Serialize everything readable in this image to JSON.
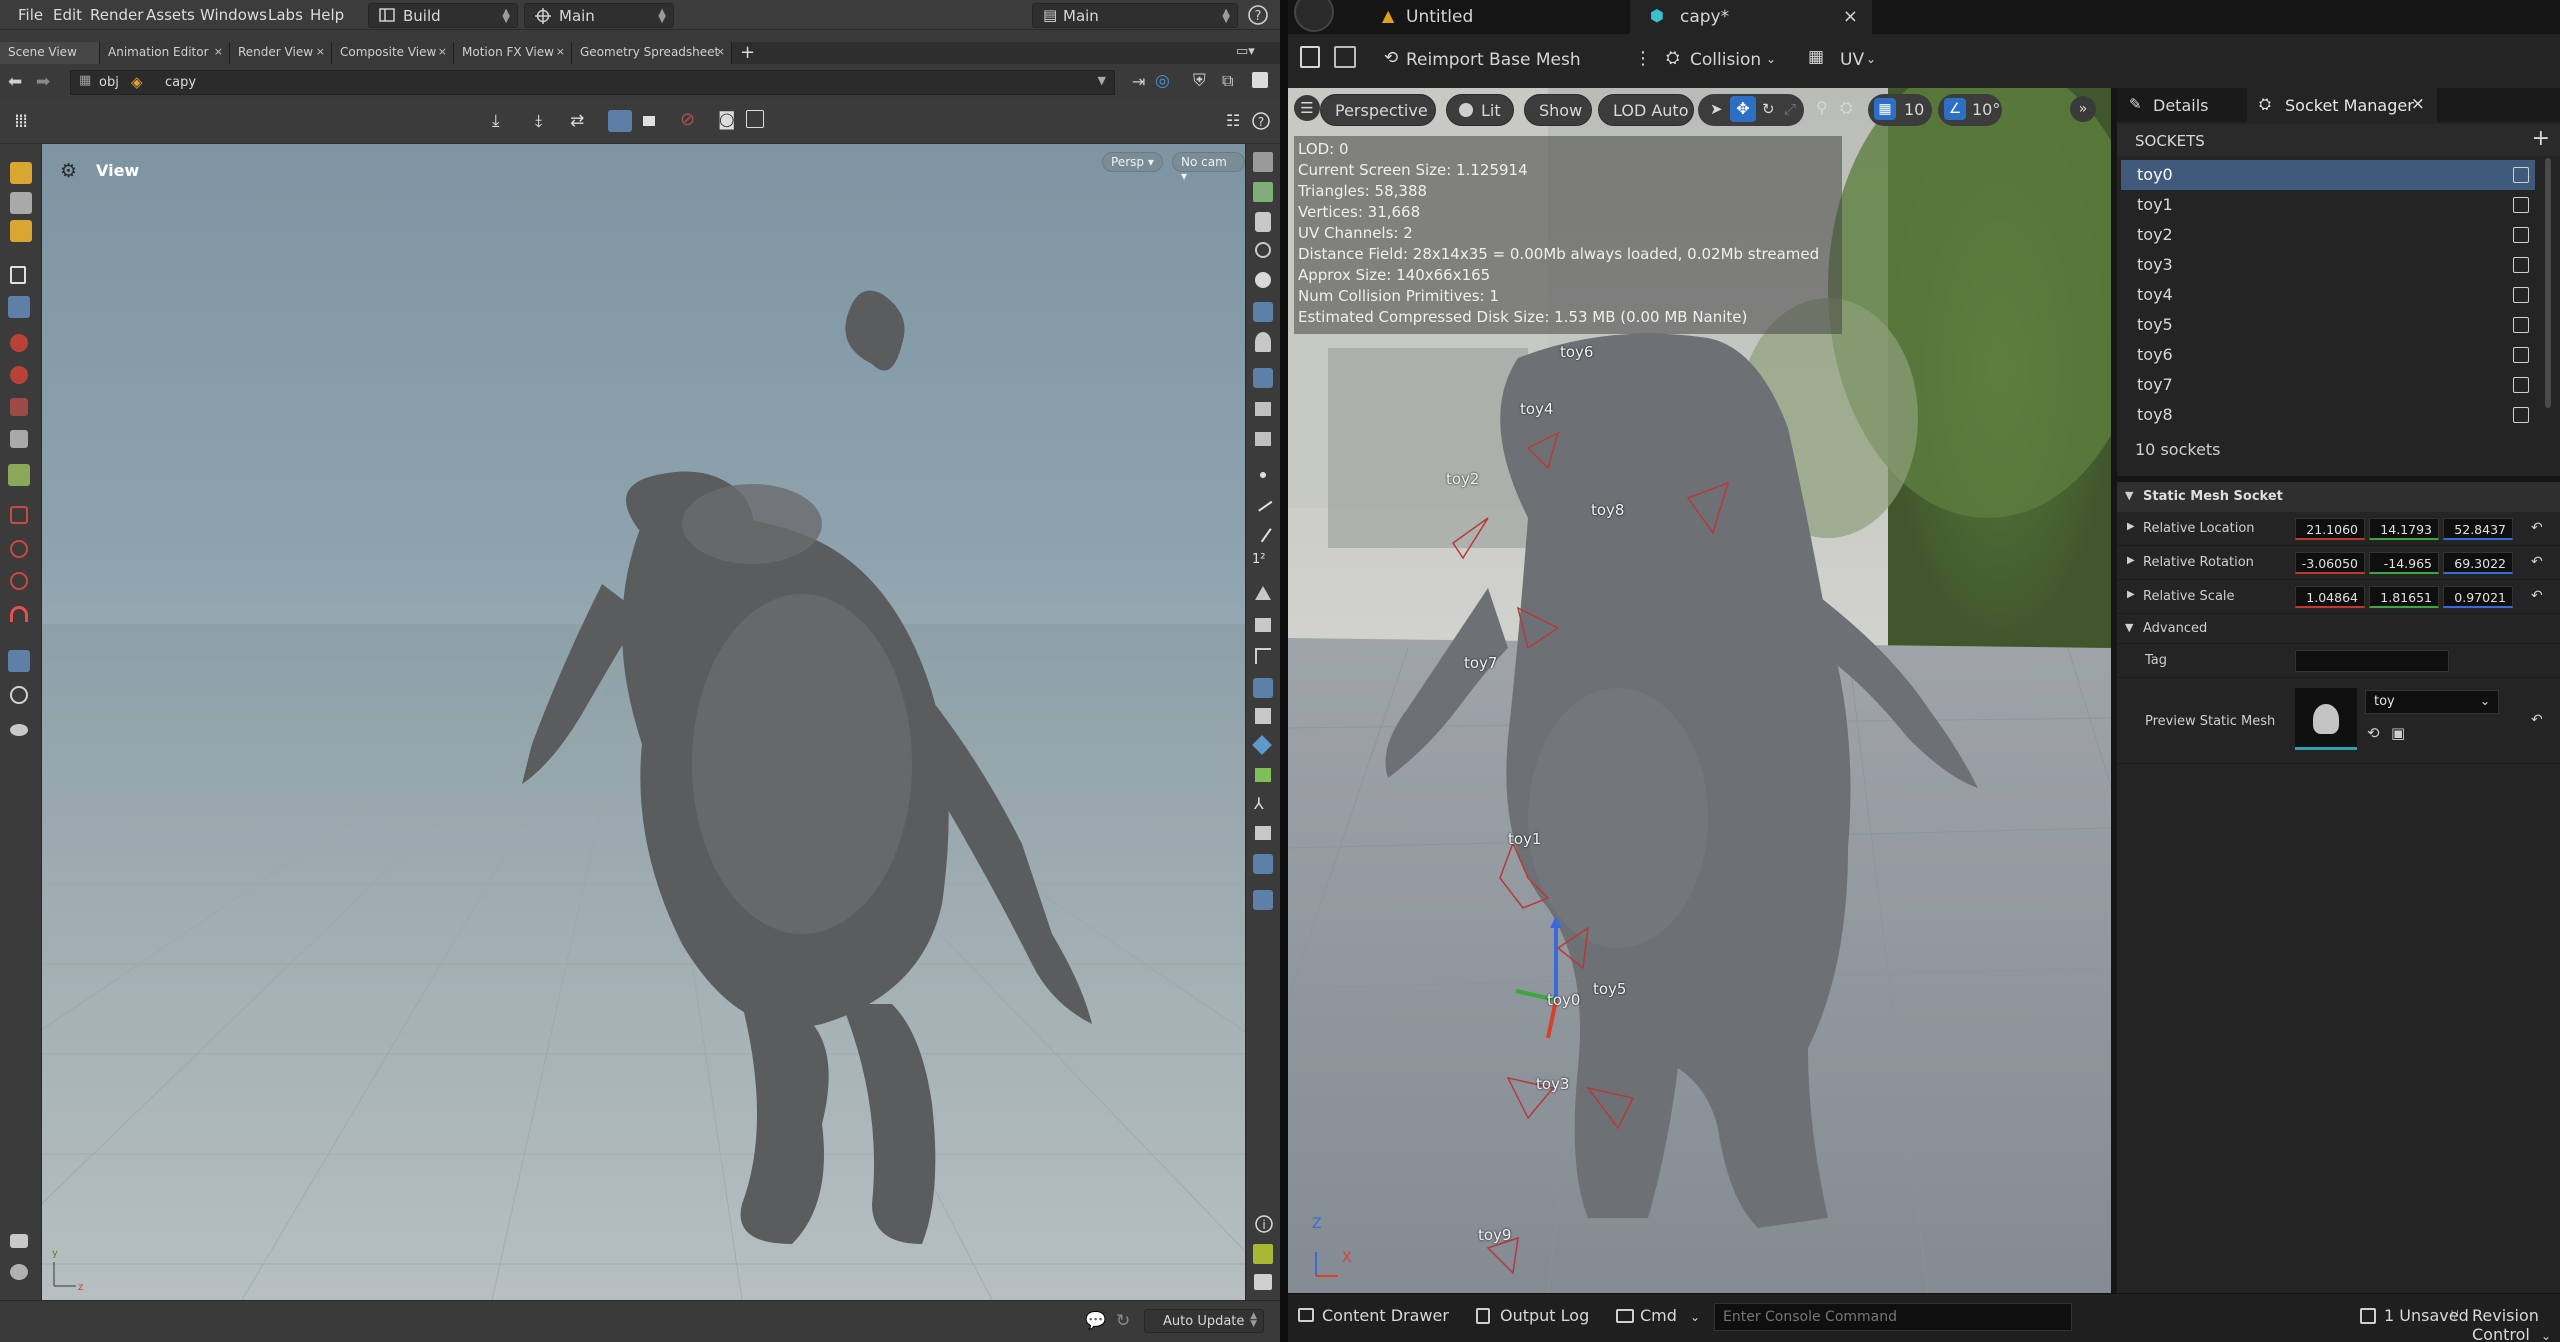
{
  "houdini": {
    "menu": [
      "File",
      "Edit",
      "Render",
      "Assets",
      "Windows",
      "Labs",
      "Help"
    ],
    "desktop": "Build",
    "context": "Main",
    "context_right": "Main",
    "pane_tabs": [
      "Scene View",
      "Animation Editor",
      "Render View",
      "Composite View",
      "Motion FX View",
      "Geometry Spreadsheet"
    ],
    "path": {
      "root": "obj",
      "node": "capy"
    },
    "viewport": {
      "title": "View",
      "camera_mode": "Persp",
      "camera": "No cam"
    },
    "status": {
      "auto_update": "Auto Update"
    }
  },
  "unreal": {
    "tabs": [
      {
        "label": "Untitled"
      },
      {
        "label": "capy*"
      }
    ],
    "toolbar": {
      "reimport": "Reimport Base Mesh",
      "collision": "Collision",
      "uv": "UV"
    },
    "viewport": {
      "perspective": "Perspective",
      "lit": "Lit",
      "show": "Show",
      "lod": "LOD Auto",
      "grid_snap": "10",
      "rot_snap": "10°",
      "stats": [
        "LOD:  0",
        "Current Screen Size:  1.125914",
        "Triangles:  58,388",
        "Vertices:  31,668",
        "UV Channels:  2",
        "Distance Field:  28x14x35 = 0.00Mb always loaded, 0.02Mb streamed",
        "Approx Size: 140x66x165",
        "Num Collision Primitives:  1",
        "Estimated Compressed Disk Size: 1.53 MB (0.00 MB Nanite)"
      ],
      "markers": [
        "toy0",
        "toy1",
        "toy2",
        "toy3",
        "toy4",
        "toy5",
        "toy6",
        "toy7",
        "toy8",
        "toy9"
      ],
      "axis": {
        "z": "Z",
        "x": "X"
      }
    },
    "panel": {
      "details_tab": "Details",
      "socket_tab": "Socket Manager",
      "sockets_header": "SOCKETS",
      "sockets": [
        "toy0",
        "toy1",
        "toy2",
        "toy3",
        "toy4",
        "toy5",
        "toy6",
        "toy7",
        "toy8"
      ],
      "selected_socket": "toy0",
      "socket_count": "10 sockets",
      "section": "Static Mesh Socket",
      "relative_location": {
        "label": "Relative Location",
        "values": [
          "21.1060",
          "14.1793",
          "52.8437"
        ]
      },
      "relative_rotation": {
        "label": "Relative Rotation",
        "values": [
          "-3.06050",
          "-14.965",
          "69.3022"
        ]
      },
      "relative_scale": {
        "label": "Relative Scale",
        "values": [
          "1.04864",
          "1.81651",
          "0.97021"
        ]
      },
      "advanced": "Advanced",
      "tag_label": "Tag",
      "tag_value": "",
      "preview_label": "Preview Static Mesh",
      "preview_value": "toy"
    },
    "bottom": {
      "content_drawer": "Content Drawer",
      "output_log": "Output Log",
      "cmd": "Cmd",
      "console_placeholder": "Enter Console Command",
      "unsaved": "1 Unsaved",
      "revision": "Revision Control"
    }
  }
}
